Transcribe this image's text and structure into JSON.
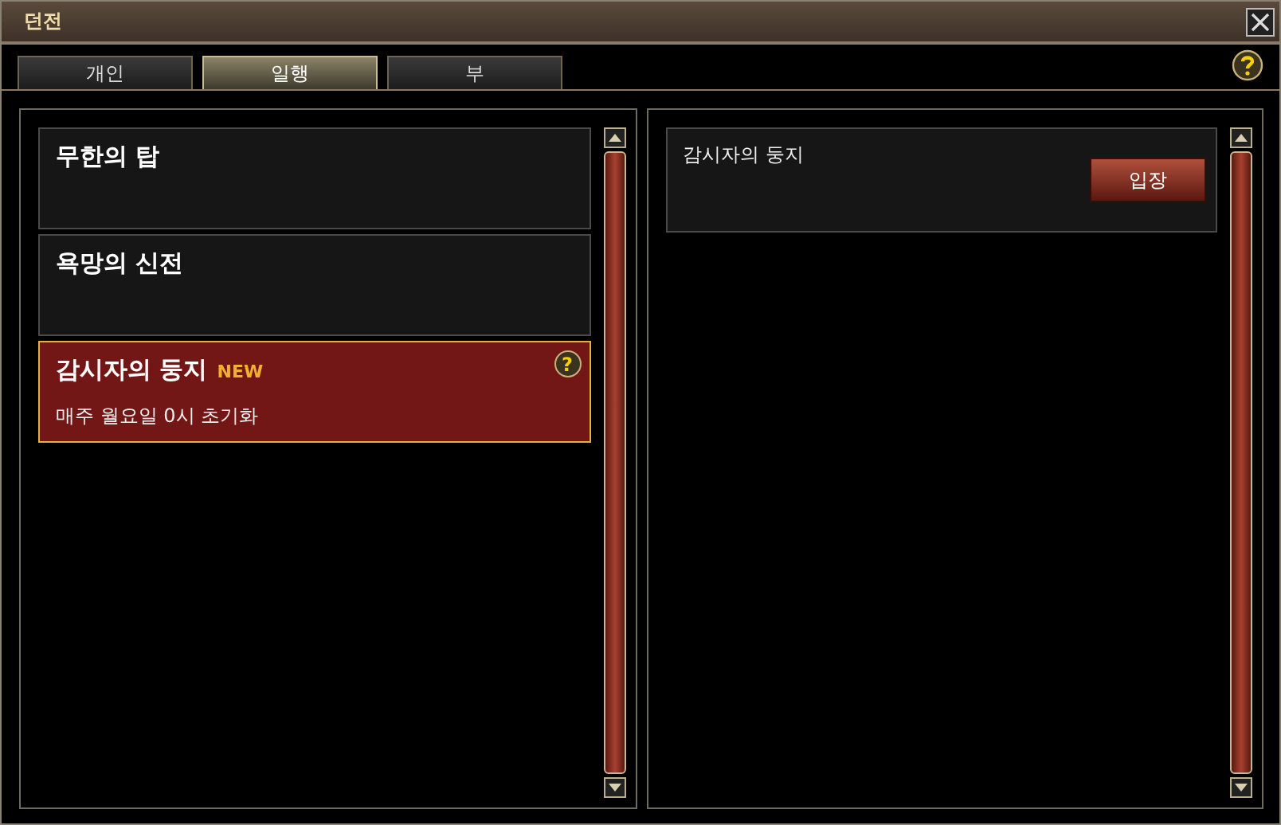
{
  "window": {
    "title": "던전"
  },
  "tabs": [
    {
      "label": "개인",
      "selected": false
    },
    {
      "label": "일행",
      "selected": true
    },
    {
      "label": "부",
      "selected": false
    }
  ],
  "dungeons": [
    {
      "name": "무한의 탑",
      "selected": false
    },
    {
      "name": "욕망의 신전",
      "selected": false
    },
    {
      "name": "감시자의 둥지",
      "badge": "NEW",
      "note": "매주 월요일 0시 초기화",
      "help": "?",
      "selected": true
    }
  ],
  "entries": [
    {
      "name": "감시자의 둥지",
      "button": "입장"
    }
  ]
}
